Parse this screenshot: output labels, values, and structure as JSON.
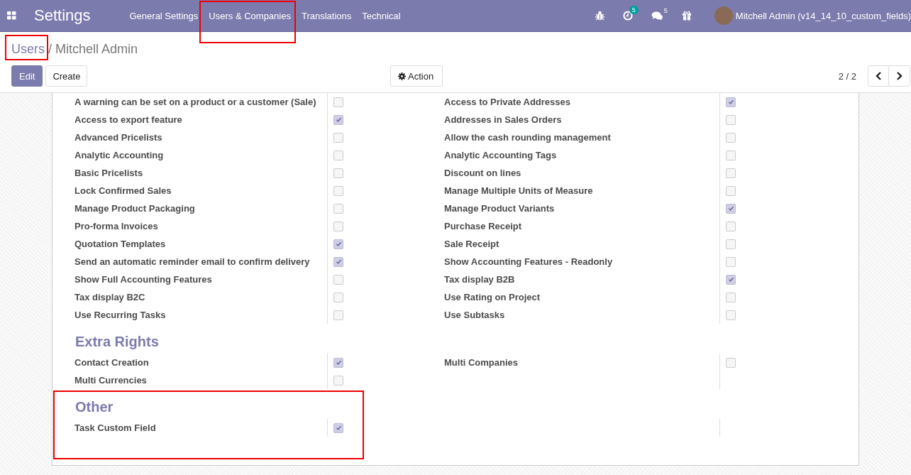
{
  "navbar": {
    "app_title": "Settings",
    "menu": [
      {
        "label": "General Settings",
        "highlighted": false
      },
      {
        "label": "Users & Companies",
        "highlighted": true
      },
      {
        "label": "Translations",
        "highlighted": false
      },
      {
        "label": "Technical",
        "highlighted": false
      }
    ],
    "activity_count": "5",
    "message_count": "5",
    "user": "Mitchell Admin (v14_14_10_custom_fields)"
  },
  "breadcrumb": {
    "parent": "Users",
    "parent_highlighted": true,
    "separator": "/",
    "current": "Mitchell Admin"
  },
  "buttons": {
    "edit": "Edit",
    "create": "Create",
    "action": "Action"
  },
  "pager": "2 / 2",
  "groups": [
    {
      "highlighted": false,
      "rows": [
        [
          {
            "label": "A warning can be set on a product or a customer (Sale)",
            "checked": false
          },
          {
            "label": "Access to Private Addresses",
            "checked": true
          }
        ],
        [
          {
            "label": "Access to export feature",
            "checked": true
          },
          {
            "label": "Addresses in Sales Orders",
            "checked": false
          }
        ],
        [
          {
            "label": "Advanced Pricelists",
            "checked": false
          },
          {
            "label": "Allow the cash rounding management",
            "checked": false
          }
        ],
        [
          {
            "label": "Analytic Accounting",
            "checked": false
          },
          {
            "label": "Analytic Accounting Tags",
            "checked": false
          }
        ],
        [
          {
            "label": "Basic Pricelists",
            "checked": false
          },
          {
            "label": "Discount on lines",
            "checked": false
          }
        ],
        [
          {
            "label": "Lock Confirmed Sales",
            "checked": false
          },
          {
            "label": "Manage Multiple Units of Measure",
            "checked": false
          }
        ],
        [
          {
            "label": "Manage Product Packaging",
            "checked": false
          },
          {
            "label": "Manage Product Variants",
            "checked": true
          }
        ],
        [
          {
            "label": "Pro-forma Invoices",
            "checked": false
          },
          {
            "label": "Purchase Receipt",
            "checked": false
          }
        ],
        [
          {
            "label": "Quotation Templates",
            "checked": true
          },
          {
            "label": "Sale Receipt",
            "checked": false
          }
        ],
        [
          {
            "label": "Send an automatic reminder email to confirm delivery",
            "checked": true
          },
          {
            "label": "Show Accounting Features - Readonly",
            "checked": false
          }
        ],
        [
          {
            "label": "Show Full Accounting Features",
            "checked": false
          },
          {
            "label": "Tax display B2B",
            "checked": true
          }
        ],
        [
          {
            "label": "Tax display B2C",
            "checked": false
          },
          {
            "label": "Use Rating on Project",
            "checked": false
          }
        ],
        [
          {
            "label": "Use Recurring Tasks",
            "checked": false
          },
          {
            "label": "Use Subtasks",
            "checked": false
          }
        ]
      ]
    },
    {
      "title": "Extra Rights",
      "highlighted": false,
      "rows": [
        [
          {
            "label": "Contact Creation",
            "checked": true
          },
          {
            "label": "Multi Companies",
            "checked": false
          }
        ],
        [
          {
            "label": "Multi Currencies",
            "checked": false
          }
        ]
      ]
    },
    {
      "title": "Other",
      "highlighted": true,
      "rows": [
        [
          {
            "label": "Task Custom Field",
            "checked": true
          }
        ]
      ]
    }
  ]
}
